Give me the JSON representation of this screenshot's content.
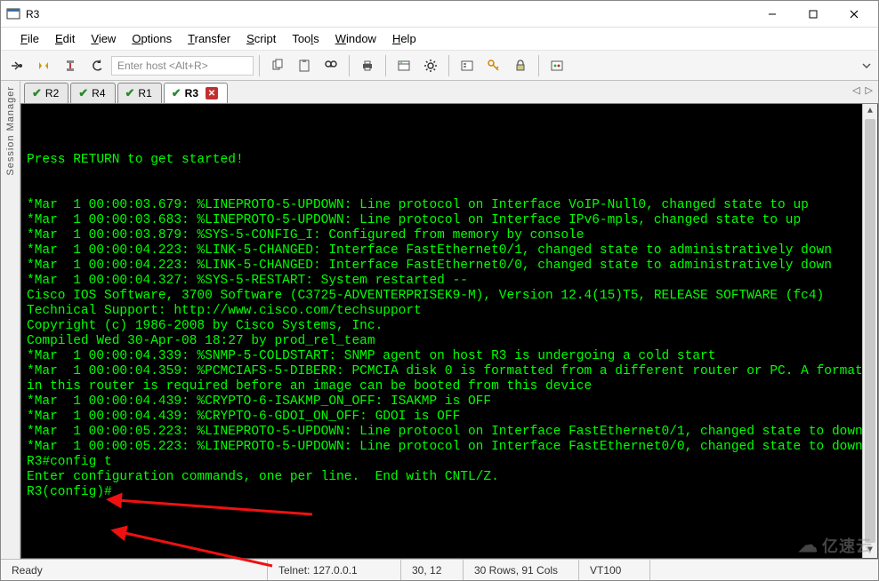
{
  "window": {
    "title": "R3",
    "min_tooltip": "Minimize",
    "max_tooltip": "Maximize",
    "close_tooltip": "Close"
  },
  "menu": {
    "file": "File",
    "edit": "Edit",
    "view": "View",
    "options": "Options",
    "transfer": "Transfer",
    "script": "Script",
    "tools": "Tools",
    "window": "Window",
    "help": "Help"
  },
  "toolbar": {
    "host_placeholder": "Enter host <Alt+R>"
  },
  "sidebar": {
    "label": "Session Manager"
  },
  "tabs": {
    "items": [
      {
        "label": "R2",
        "active": false
      },
      {
        "label": "R4",
        "active": false
      },
      {
        "label": "R1",
        "active": false
      },
      {
        "label": "R3",
        "active": true
      }
    ]
  },
  "terminal": {
    "lines": [
      "Press RETURN to get started!",
      "",
      "",
      "*Mar  1 00:00:03.679: %LINEPROTO-5-UPDOWN: Line protocol on Interface VoIP-Null0, changed state to up",
      "*Mar  1 00:00:03.683: %LINEPROTO-5-UPDOWN: Line protocol on Interface IPv6-mpls, changed state to up",
      "*Mar  1 00:00:03.879: %SYS-5-CONFIG_I: Configured from memory by console",
      "*Mar  1 00:00:04.223: %LINK-5-CHANGED: Interface FastEthernet0/1, changed state to administratively down",
      "*Mar  1 00:00:04.223: %LINK-5-CHANGED: Interface FastEthernet0/0, changed state to administratively down",
      "*Mar  1 00:00:04.327: %SYS-5-RESTART: System restarted --",
      "Cisco IOS Software, 3700 Software (C3725-ADVENTERPRISEK9-M), Version 12.4(15)T5, RELEASE SOFTWARE (fc4)",
      "Technical Support: http://www.cisco.com/techsupport",
      "Copyright (c) 1986-2008 by Cisco Systems, Inc.",
      "Compiled Wed 30-Apr-08 18:27 by prod_rel_team",
      "*Mar  1 00:00:04.339: %SNMP-5-COLDSTART: SNMP agent on host R3 is undergoing a cold start",
      "*Mar  1 00:00:04.359: %PCMCIAFS-5-DIBERR: PCMCIA disk 0 is formatted from a different router or PC. A format in this router is required before an image can be booted from this device",
      "*Mar  1 00:00:04.439: %CRYPTO-6-ISAKMP_ON_OFF: ISAKMP is OFF",
      "*Mar  1 00:00:04.439: %CRYPTO-6-GDOI_ON_OFF: GDOI is OFF",
      "*Mar  1 00:00:05.223: %LINEPROTO-5-UPDOWN: Line protocol on Interface FastEthernet0/1, changed state to down",
      "*Mar  1 00:00:05.223: %LINEPROTO-5-UPDOWN: Line protocol on Interface FastEthernet0/0, changed state to down",
      "R3#config t",
      "Enter configuration commands, one per line.  End with CNTL/Z.",
      "R3(config)#"
    ]
  },
  "status": {
    "ready": "Ready",
    "conn": "Telnet: 127.0.0.1",
    "pos": "30,  12",
    "size": "30 Rows, 91 Cols",
    "term": "VT100"
  },
  "watermark": "亿速云"
}
